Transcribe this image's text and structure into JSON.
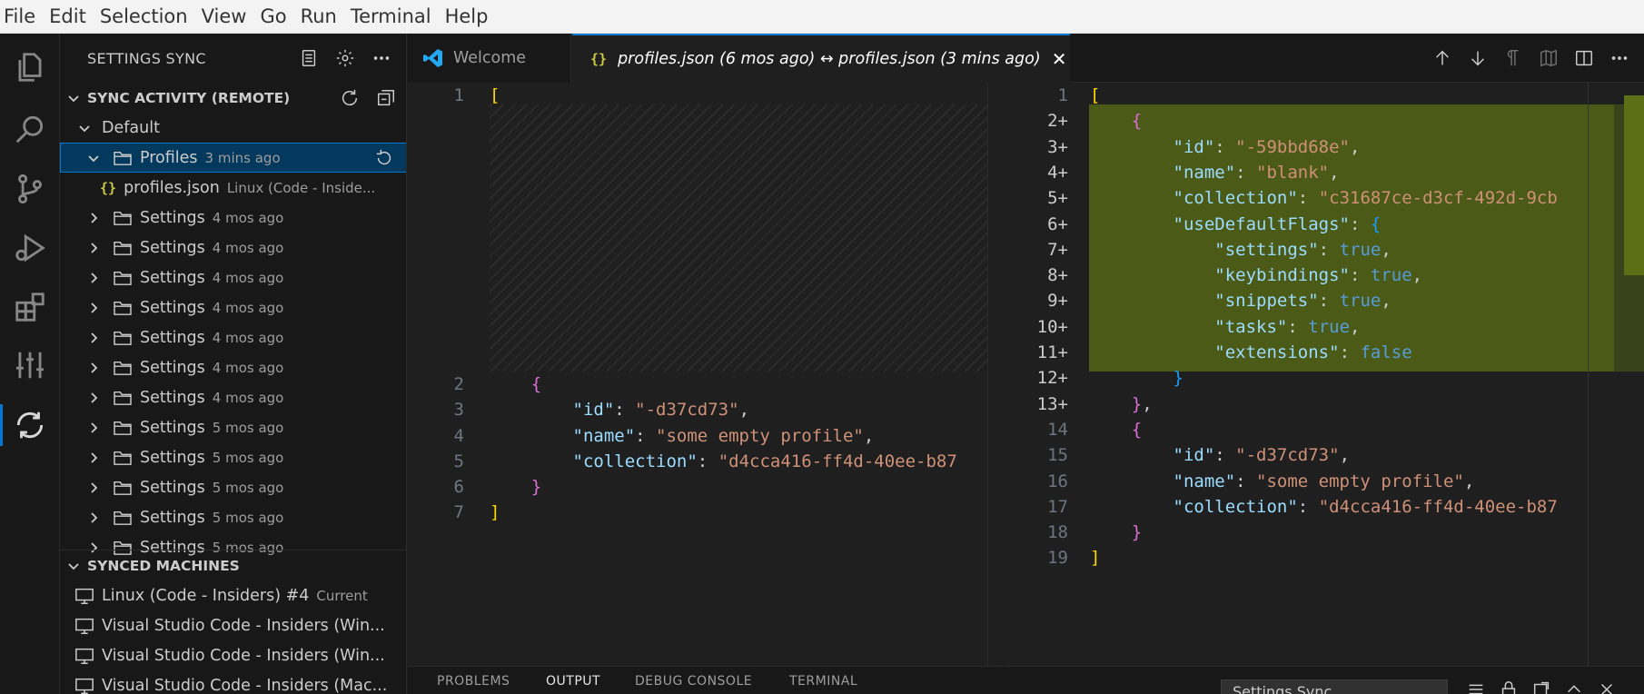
{
  "menu": [
    "File",
    "Edit",
    "Selection",
    "View",
    "Go",
    "Run",
    "Terminal",
    "Help"
  ],
  "activity_bar": [
    {
      "name": "explorer-icon"
    },
    {
      "name": "search-icon"
    },
    {
      "name": "source-control-icon"
    },
    {
      "name": "run-debug-icon"
    },
    {
      "name": "extensions-icon"
    },
    {
      "name": "settings-editor-icon"
    },
    {
      "name": "settings-sync-icon",
      "active": true
    }
  ],
  "sidebar": {
    "title": "SETTINGS SYNC",
    "sync_activity": {
      "title": "SYNC ACTIVITY (REMOTE)",
      "default_label": "Default",
      "profiles": {
        "label": "Profiles",
        "time": "3 mins ago"
      },
      "profiles_file": {
        "label": "profiles.json",
        "desc": "Linux (Code - Inside..."
      },
      "settings_items": [
        {
          "label": "Settings",
          "time": "4 mos ago"
        },
        {
          "label": "Settings",
          "time": "4 mos ago"
        },
        {
          "label": "Settings",
          "time": "4 mos ago"
        },
        {
          "label": "Settings",
          "time": "4 mos ago"
        },
        {
          "label": "Settings",
          "time": "4 mos ago"
        },
        {
          "label": "Settings",
          "time": "4 mos ago"
        },
        {
          "label": "Settings",
          "time": "4 mos ago"
        },
        {
          "label": "Settings",
          "time": "5 mos ago"
        },
        {
          "label": "Settings",
          "time": "5 mos ago"
        },
        {
          "label": "Settings",
          "time": "5 mos ago"
        },
        {
          "label": "Settings",
          "time": "5 mos ago"
        },
        {
          "label": "Settings",
          "time": "5 mos ago"
        }
      ]
    },
    "synced_machines": {
      "title": "SYNCED MACHINES",
      "items": [
        {
          "label": "Linux (Code - Insiders) #4",
          "desc": "Current"
        },
        {
          "label": "Visual Studio Code - Insiders (Win...",
          "desc": ""
        },
        {
          "label": "Visual Studio Code - Insiders (Win...",
          "desc": ""
        },
        {
          "label": "Visual Studio Code - Insiders (Mac...",
          "desc": ""
        }
      ]
    }
  },
  "tabs": [
    {
      "label": "Welcome",
      "active": false
    },
    {
      "label": "profiles.json (6 mos ago) ↔ profiles.json (3 mins ago)",
      "active": true
    }
  ],
  "left_editor": {
    "line_numbers": [
      "1",
      "2",
      "3",
      "4",
      "5",
      "6",
      "7"
    ],
    "lines": [
      [
        {
          "t": "[",
          "c": "brk"
        }
      ],
      [
        {
          "t": "    ",
          "c": "punc"
        },
        {
          "t": "{",
          "c": "brace"
        }
      ],
      [
        {
          "t": "        ",
          "c": "punc"
        },
        {
          "t": "\"id\"",
          "c": "key"
        },
        {
          "t": ": ",
          "c": "punc"
        },
        {
          "t": "\"-d37cd73\"",
          "c": "str"
        },
        {
          "t": ",",
          "c": "punc"
        }
      ],
      [
        {
          "t": "        ",
          "c": "punc"
        },
        {
          "t": "\"name\"",
          "c": "key"
        },
        {
          "t": ": ",
          "c": "punc"
        },
        {
          "t": "\"some empty profile\"",
          "c": "str"
        },
        {
          "t": ",",
          "c": "punc"
        }
      ],
      [
        {
          "t": "        ",
          "c": "punc"
        },
        {
          "t": "\"collection\"",
          "c": "key"
        },
        {
          "t": ": ",
          "c": "punc"
        },
        {
          "t": "\"d4cca416-ff4d-40ee-b87",
          "c": "str"
        }
      ],
      [
        {
          "t": "    ",
          "c": "punc"
        },
        {
          "t": "}",
          "c": "brace"
        }
      ],
      [
        {
          "t": "]",
          "c": "brk"
        }
      ]
    ]
  },
  "right_editor": {
    "line_numbers": [
      "1",
      "2+",
      "3+",
      "4+",
      "5+",
      "6+",
      "7+",
      "8+",
      "9+",
      "10+",
      "11+",
      "12+",
      "13+",
      "14",
      "15",
      "16",
      "17",
      "18",
      "19"
    ],
    "lines": [
      [
        {
          "t": "[",
          "c": "brk"
        }
      ],
      [
        {
          "t": "    ",
          "c": "punc"
        },
        {
          "t": "{",
          "c": "brace"
        }
      ],
      [
        {
          "t": "        ",
          "c": "punc"
        },
        {
          "t": "\"id\"",
          "c": "key"
        },
        {
          "t": ": ",
          "c": "punc"
        },
        {
          "t": "\"-59bbd68e\"",
          "c": "str"
        },
        {
          "t": ",",
          "c": "punc"
        }
      ],
      [
        {
          "t": "        ",
          "c": "punc"
        },
        {
          "t": "\"name\"",
          "c": "key"
        },
        {
          "t": ": ",
          "c": "punc"
        },
        {
          "t": "\"blank\"",
          "c": "str"
        },
        {
          "t": ",",
          "c": "punc"
        }
      ],
      [
        {
          "t": "        ",
          "c": "punc"
        },
        {
          "t": "\"collection\"",
          "c": "key"
        },
        {
          "t": ": ",
          "c": "punc"
        },
        {
          "t": "\"c31687ce-d3cf-492d-9cb",
          "c": "str"
        }
      ],
      [
        {
          "t": "        ",
          "c": "punc"
        },
        {
          "t": "\"useDefaultFlags\"",
          "c": "key"
        },
        {
          "t": ": ",
          "c": "punc"
        },
        {
          "t": "{",
          "c": "brace2"
        }
      ],
      [
        {
          "t": "            ",
          "c": "punc"
        },
        {
          "t": "\"settings\"",
          "c": "key"
        },
        {
          "t": ": ",
          "c": "punc"
        },
        {
          "t": "true",
          "c": "bool"
        },
        {
          "t": ",",
          "c": "punc"
        }
      ],
      [
        {
          "t": "            ",
          "c": "punc"
        },
        {
          "t": "\"keybindings\"",
          "c": "key"
        },
        {
          "t": ": ",
          "c": "punc"
        },
        {
          "t": "true",
          "c": "bool"
        },
        {
          "t": ",",
          "c": "punc"
        }
      ],
      [
        {
          "t": "            ",
          "c": "punc"
        },
        {
          "t": "\"snippets\"",
          "c": "key"
        },
        {
          "t": ": ",
          "c": "punc"
        },
        {
          "t": "true",
          "c": "bool"
        },
        {
          "t": ",",
          "c": "punc"
        }
      ],
      [
        {
          "t": "            ",
          "c": "punc"
        },
        {
          "t": "\"tasks\"",
          "c": "key"
        },
        {
          "t": ": ",
          "c": "punc"
        },
        {
          "t": "true",
          "c": "bool"
        },
        {
          "t": ",",
          "c": "punc"
        }
      ],
      [
        {
          "t": "            ",
          "c": "punc"
        },
        {
          "t": "\"extensions\"",
          "c": "key"
        },
        {
          "t": ": ",
          "c": "punc"
        },
        {
          "t": "false",
          "c": "bool"
        }
      ],
      [
        {
          "t": "        ",
          "c": "punc"
        },
        {
          "t": "}",
          "c": "brace2"
        }
      ],
      [
        {
          "t": "    ",
          "c": "punc"
        },
        {
          "t": "}",
          "c": "brace"
        },
        {
          "t": ",",
          "c": "punc"
        }
      ],
      [
        {
          "t": "    ",
          "c": "punc"
        },
        {
          "t": "{",
          "c": "brace"
        }
      ],
      [
        {
          "t": "        ",
          "c": "punc"
        },
        {
          "t": "\"id\"",
          "c": "key"
        },
        {
          "t": ": ",
          "c": "punc"
        },
        {
          "t": "\"-d37cd73\"",
          "c": "str"
        },
        {
          "t": ",",
          "c": "punc"
        }
      ],
      [
        {
          "t": "        ",
          "c": "punc"
        },
        {
          "t": "\"name\"",
          "c": "key"
        },
        {
          "t": ": ",
          "c": "punc"
        },
        {
          "t": "\"some empty profile\"",
          "c": "str"
        },
        {
          "t": ",",
          "c": "punc"
        }
      ],
      [
        {
          "t": "        ",
          "c": "punc"
        },
        {
          "t": "\"collection\"",
          "c": "key"
        },
        {
          "t": ": ",
          "c": "punc"
        },
        {
          "t": "\"d4cca416-ff4d-40ee-b87",
          "c": "str"
        }
      ],
      [
        {
          "t": "    ",
          "c": "punc"
        },
        {
          "t": "}",
          "c": "brace"
        }
      ],
      [
        {
          "t": "]",
          "c": "brk"
        }
      ]
    ]
  },
  "panel": {
    "tabs": [
      "PROBLEMS",
      "OUTPUT",
      "DEBUG CONSOLE",
      "TERMINAL"
    ],
    "active_tab": "OUTPUT",
    "output_channel": "Settings Sync"
  },
  "colors": {
    "accent": "#0078d4",
    "added_line": "#4b5a16",
    "selection": "#04395e"
  }
}
